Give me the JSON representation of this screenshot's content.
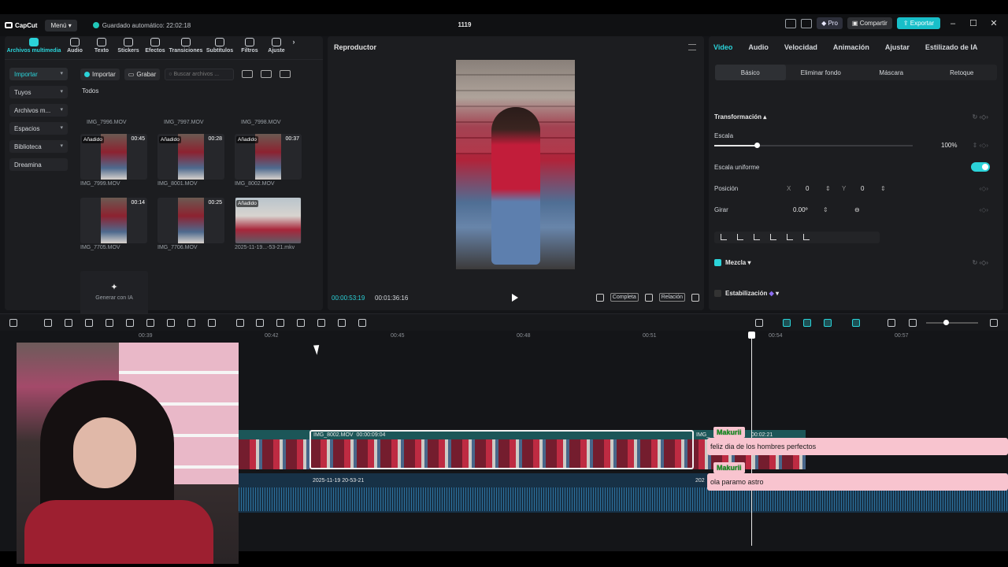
{
  "titlebar": {
    "app_name": "CapCut",
    "menu_label": "Menú",
    "autosave": "Guardado automático: 22:02:18",
    "project_name": "1119",
    "pro_label": "Pro",
    "share_label": "Compartir",
    "export_label": "Exportar"
  },
  "toolbar": {
    "items": [
      "Archivos multimedia",
      "Audio",
      "Texto",
      "Stickers",
      "Efectos",
      "Transiciones",
      "Subtítulos",
      "Filtros",
      "Ajuste"
    ]
  },
  "sidebar": {
    "items": [
      {
        "label": "Importar"
      },
      {
        "label": "Tuyos"
      },
      {
        "label": "Archivos m..."
      },
      {
        "label": "Espacios"
      },
      {
        "label": "Biblioteca"
      },
      {
        "label": "Dreamina"
      }
    ]
  },
  "media": {
    "import_label": "Importar",
    "record_label": "Grabar",
    "search_placeholder": "Buscar archivos ...",
    "section": "Todos",
    "added_tag": "Añadido",
    "top_row": [
      "IMG_7996.MOV",
      "IMG_7997.MOV",
      "IMG_7998.MOV"
    ],
    "clips": [
      {
        "name": "IMG_7999.MOV",
        "duration": "00:45",
        "added": true
      },
      {
        "name": "IMG_8001.MOV",
        "duration": "00:28",
        "added": true
      },
      {
        "name": "IMG_8002.MOV",
        "duration": "00:37",
        "added": true
      },
      {
        "name": "IMG_7705.MOV",
        "duration": "00:14",
        "added": false
      },
      {
        "name": "IMG_7706.MOV",
        "duration": "00:25",
        "added": false
      },
      {
        "name": "2025-11-19...-53-21.mkv",
        "duration": "",
        "added": true
      }
    ],
    "generate_label": "Generar con IA"
  },
  "player": {
    "title": "Reproductor",
    "current_time": "00:00:53:19",
    "total_time": "00:01:36:16",
    "full_label": "Completa",
    "ratio_label": "Relación"
  },
  "props": {
    "tabs": [
      "Video",
      "Audio",
      "Velocidad",
      "Animación",
      "Ajustar",
      "Estilizado de IA"
    ],
    "subtabs": [
      "Básico",
      "Eliminar fondo",
      "Máscara",
      "Retoque"
    ],
    "transform_label": "Transformación",
    "scale_label": "Escala",
    "scale_value": "100%",
    "scale_fraction": 0.2,
    "uniform_label": "Escala uniforme",
    "position_label": "Posición",
    "pos_x_label": "X",
    "pos_x": "0",
    "pos_y_label": "Y",
    "pos_y": "0",
    "rotate_label": "Girar",
    "rotate_value": "0.00º",
    "blend_label": "Mezcla",
    "stabilize_label": "Estabilización"
  },
  "timeline": {
    "ruler": [
      "00:39",
      "00:42",
      "00:45",
      "00:48",
      "00:51",
      "00:54",
      "00:57"
    ],
    "video_clip_label": "IMG_8002.MOV",
    "video_clip_duration": "00:00:09:04",
    "next_clip_label": "IMG_",
    "next_clip_duration": "00:02:21",
    "audio_clip_label": "2025-11-19 20-53-21",
    "audio_clip_next": "202"
  },
  "stream_chat": [
    {
      "user": "Makurii",
      "message": "feliz dia de los hombres perfectos"
    },
    {
      "user": "Makurii",
      "message": "ola paramo astro"
    }
  ],
  "colors": {
    "accent": "#2bd3d9",
    "export": "#18bfc9",
    "chat_bg": "#f8c4cf"
  }
}
